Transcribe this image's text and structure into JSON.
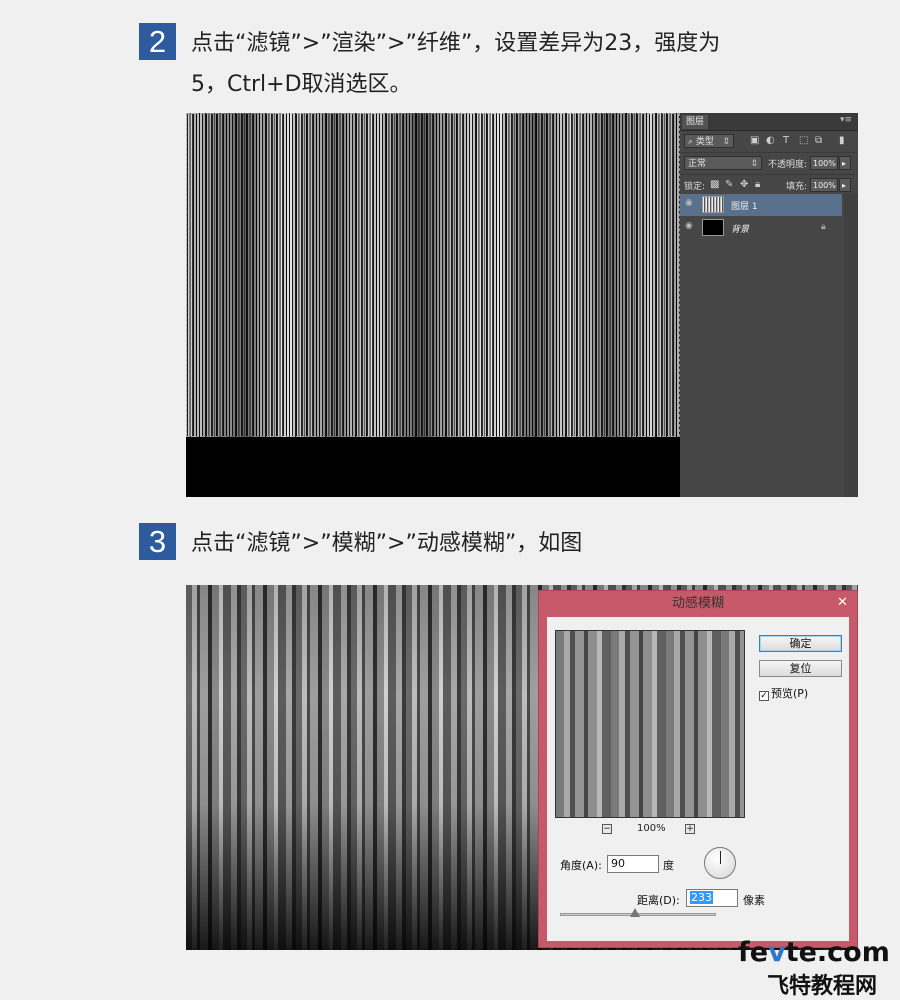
{
  "step2": {
    "number": "2",
    "line1": "点击“滤镜”>”渲染”>”纤维”，设置差异为23，强度为",
    "line2": "5，Ctrl+D取消选区。",
    "layers_panel": {
      "tab": "图层",
      "menu_icon": "panel-menu-icon",
      "filter_kind": "类型",
      "blend_mode": "正常",
      "opacity_label": "不透明度:",
      "opacity_value": "100%",
      "lock_label": "锁定:",
      "fill_label": "填充:",
      "fill_value": "100%",
      "layers": [
        {
          "name": "图层 1",
          "selected": true
        },
        {
          "name": "背景",
          "selected": false,
          "locked": true
        }
      ]
    }
  },
  "step3": {
    "number": "3",
    "line1": "点击“滤镜”>”模糊”>”动感模糊”，如图",
    "dialog": {
      "title": "动感模糊",
      "close": "✕",
      "ok": "确定",
      "reset": "复位",
      "preview_label": "预览(P)",
      "preview_checked": true,
      "zoom_out": "−",
      "zoom_in": "+",
      "zoom_value": "100%",
      "angle_label": "角度(A):",
      "angle_value": "90",
      "angle_unit": "度",
      "distance_label": "距离(D):",
      "distance_value": "233",
      "distance_unit": "像素"
    }
  },
  "watermark": {
    "line1_a": "fe",
    "line1_b": "v",
    "line1_c": "te.com",
    "line2": "飞特教程网"
  },
  "colors": {
    "badge": "#2d5b9e",
    "dialog_frame": "#c75a6a",
    "selected_layer": "#59708c"
  }
}
